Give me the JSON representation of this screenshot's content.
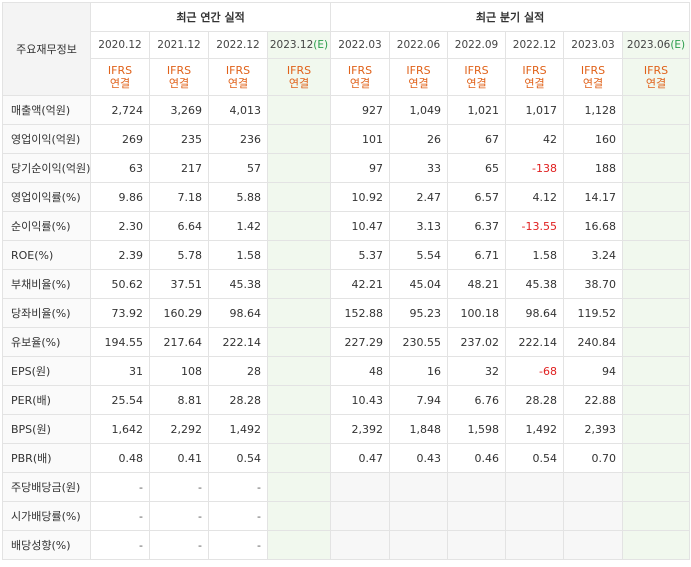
{
  "header": {
    "label": "주요재무정보",
    "annual_title": "최근 연간 실적",
    "quarter_title": "최근 분기 실적",
    "ifrs_line1": "IFRS",
    "ifrs_line2": "연결"
  },
  "periods": {
    "annual": [
      "2020.12",
      "2021.12",
      "2022.12",
      "2023.12"
    ],
    "annual_est": "(E)",
    "quarter": [
      "2022.03",
      "2022.06",
      "2022.09",
      "2022.12",
      "2023.03",
      "2023.06"
    ],
    "quarter_est": "(E)"
  },
  "rows": [
    {
      "label": "매출액(억원)",
      "annual": [
        "2,724",
        "3,269",
        "4,013",
        ""
      ],
      "quarter": [
        "927",
        "1,049",
        "1,021",
        "1,017",
        "1,128",
        ""
      ]
    },
    {
      "label": "영업이익(억원)",
      "annual": [
        "269",
        "235",
        "236",
        ""
      ],
      "quarter": [
        "101",
        "26",
        "67",
        "42",
        "160",
        ""
      ]
    },
    {
      "label": "당기순이익(억원)",
      "annual": [
        "63",
        "217",
        "57",
        ""
      ],
      "quarter": [
        "97",
        "33",
        "65",
        "-138",
        "188",
        ""
      ]
    },
    {
      "label": "영업이익률(%)",
      "annual": [
        "9.86",
        "7.18",
        "5.88",
        ""
      ],
      "quarter": [
        "10.92",
        "2.47",
        "6.57",
        "4.12",
        "14.17",
        ""
      ]
    },
    {
      "label": "순이익률(%)",
      "annual": [
        "2.30",
        "6.64",
        "1.42",
        ""
      ],
      "quarter": [
        "10.47",
        "3.13",
        "6.37",
        "-13.55",
        "16.68",
        ""
      ]
    },
    {
      "label": "ROE(%)",
      "annual": [
        "2.39",
        "5.78",
        "1.58",
        ""
      ],
      "quarter": [
        "5.37",
        "5.54",
        "6.71",
        "1.58",
        "3.24",
        ""
      ]
    },
    {
      "label": "부채비율(%)",
      "annual": [
        "50.62",
        "37.51",
        "45.38",
        ""
      ],
      "quarter": [
        "42.21",
        "45.04",
        "48.21",
        "45.38",
        "38.70",
        ""
      ]
    },
    {
      "label": "당좌비율(%)",
      "annual": [
        "73.92",
        "160.29",
        "98.64",
        ""
      ],
      "quarter": [
        "152.88",
        "95.23",
        "100.18",
        "98.64",
        "119.52",
        ""
      ]
    },
    {
      "label": "유보율(%)",
      "annual": [
        "194.55",
        "217.64",
        "222.14",
        ""
      ],
      "quarter": [
        "227.29",
        "230.55",
        "237.02",
        "222.14",
        "240.84",
        ""
      ]
    },
    {
      "label": "EPS(원)",
      "annual": [
        "31",
        "108",
        "28",
        ""
      ],
      "quarter": [
        "48",
        "16",
        "32",
        "-68",
        "94",
        ""
      ]
    },
    {
      "label": "PER(배)",
      "annual": [
        "25.54",
        "8.81",
        "28.28",
        ""
      ],
      "quarter": [
        "10.43",
        "7.94",
        "6.76",
        "28.28",
        "22.88",
        ""
      ]
    },
    {
      "label": "BPS(원)",
      "annual": [
        "1,642",
        "2,292",
        "1,492",
        ""
      ],
      "quarter": [
        "2,392",
        "1,848",
        "1,598",
        "1,492",
        "2,393",
        ""
      ]
    },
    {
      "label": "PBR(배)",
      "annual": [
        "0.48",
        "0.41",
        "0.54",
        ""
      ],
      "quarter": [
        "0.47",
        "0.43",
        "0.46",
        "0.54",
        "0.70",
        ""
      ]
    },
    {
      "label": "주당배당금(원)",
      "annual": [
        "-",
        "-",
        "-",
        ""
      ],
      "quarter": [
        "",
        "",
        "",
        "",
        "",
        ""
      ]
    },
    {
      "label": "시가배당률(%)",
      "annual": [
        "-",
        "-",
        "-",
        ""
      ],
      "quarter": [
        "",
        "",
        "",
        "",
        "",
        ""
      ]
    },
    {
      "label": "배당성향(%)",
      "annual": [
        "-",
        "-",
        "-",
        ""
      ],
      "quarter": [
        "",
        "",
        "",
        "",
        "",
        ""
      ]
    }
  ],
  "group_starts": [
    0,
    3,
    6,
    9,
    13
  ],
  "colors": {
    "negative": "#e02020",
    "ifrs": "#e0621a",
    "estimate_bg": "#f1f8ee",
    "estimate_text": "#2a9d4b"
  }
}
